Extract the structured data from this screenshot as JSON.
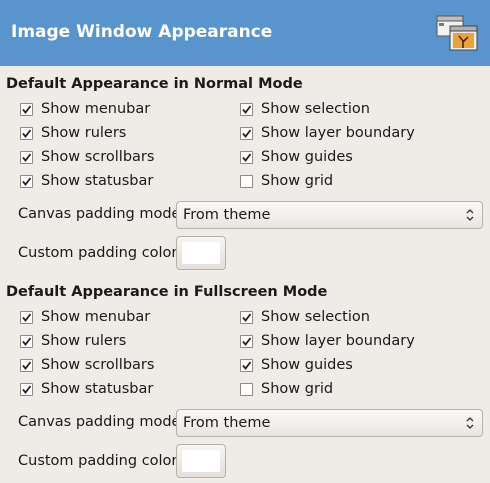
{
  "header": {
    "title": "Image Window Appearance",
    "icon": "image-window-icon",
    "color": "#5995cc"
  },
  "sections": [
    {
      "heading": "Default Appearance in Normal Mode",
      "checkboxes": [
        {
          "label": "Show menubar",
          "checked": true
        },
        {
          "label": "Show rulers",
          "checked": true
        },
        {
          "label": "Show scrollbars",
          "checked": true
        },
        {
          "label": "Show statusbar",
          "checked": true
        },
        {
          "label": "Show selection",
          "checked": true
        },
        {
          "label": "Show layer boundary",
          "checked": true
        },
        {
          "label": "Show guides",
          "checked": true
        },
        {
          "label": "Show grid",
          "checked": false
        }
      ],
      "padding_mode_label": "Canvas padding mode:",
      "padding_mode_value": "From theme",
      "padding_color_label": "Custom padding color:",
      "padding_color": "#ffffff"
    },
    {
      "heading": "Default Appearance in Fullscreen Mode",
      "checkboxes": [
        {
          "label": "Show menubar",
          "checked": true
        },
        {
          "label": "Show rulers",
          "checked": true
        },
        {
          "label": "Show scrollbars",
          "checked": true
        },
        {
          "label": "Show statusbar",
          "checked": true
        },
        {
          "label": "Show selection",
          "checked": true
        },
        {
          "label": "Show layer boundary",
          "checked": true
        },
        {
          "label": "Show guides",
          "checked": true
        },
        {
          "label": "Show grid",
          "checked": false
        }
      ],
      "padding_mode_label": "Canvas padding mode:",
      "padding_mode_value": "From theme",
      "padding_color_label": "Custom padding color:",
      "padding_color": "#ffffff"
    }
  ]
}
